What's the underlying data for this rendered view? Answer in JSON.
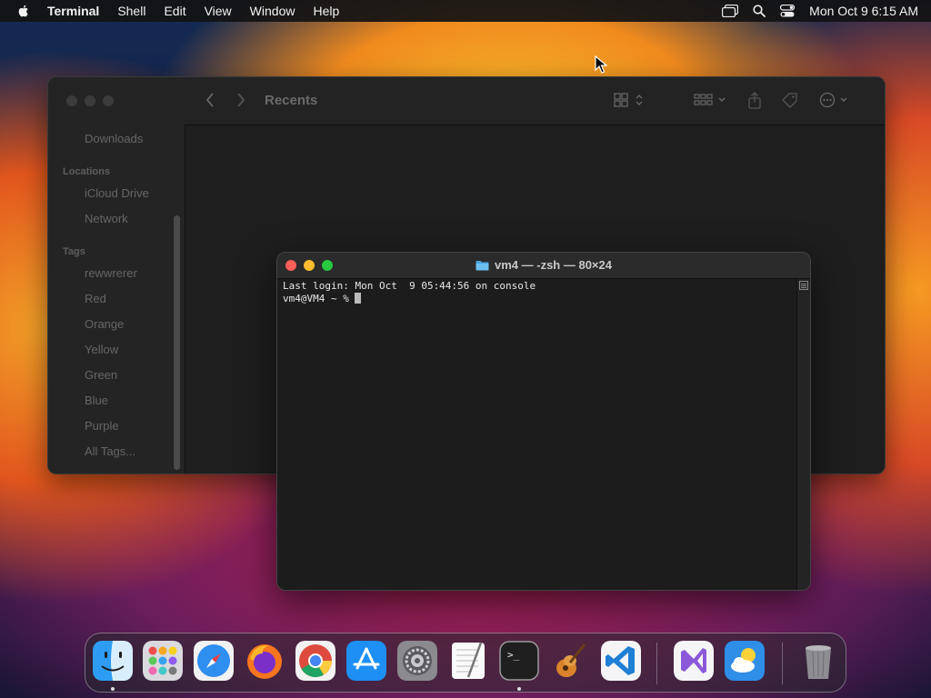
{
  "menubar": {
    "app_name": "Terminal",
    "items": [
      "Shell",
      "Edit",
      "View",
      "Window",
      "Help"
    ],
    "clock": "Mon Oct 9  6:15 AM"
  },
  "finder": {
    "title": "Recents",
    "sidebar": {
      "top_items": [
        "Downloads"
      ],
      "locations_header": "Locations",
      "locations": [
        "iCloud Drive",
        "Network"
      ],
      "tags_header": "Tags",
      "tags": [
        "rewwrerer",
        "Red",
        "Orange",
        "Yellow",
        "Green",
        "Blue",
        "Purple",
        "All Tags..."
      ]
    }
  },
  "terminal": {
    "title": "vm4 — -zsh — 80×24",
    "lines": [
      "Last login: Mon Oct  9 05:44:56 on console",
      "vm4@VM4 ~ % "
    ]
  },
  "dock": {
    "apps": [
      "finder",
      "launchpad",
      "safari",
      "firefox",
      "chrome",
      "app-store",
      "system-settings",
      "textedit",
      "terminal",
      "garageband",
      "vscode",
      "visual-studio",
      "weather",
      "trash"
    ],
    "running": [
      "finder",
      "terminal"
    ]
  },
  "colors": {
    "close": "#fe5f57",
    "minimize": "#febc2e",
    "zoom": "#28c840",
    "folder": "#4aa3df"
  }
}
